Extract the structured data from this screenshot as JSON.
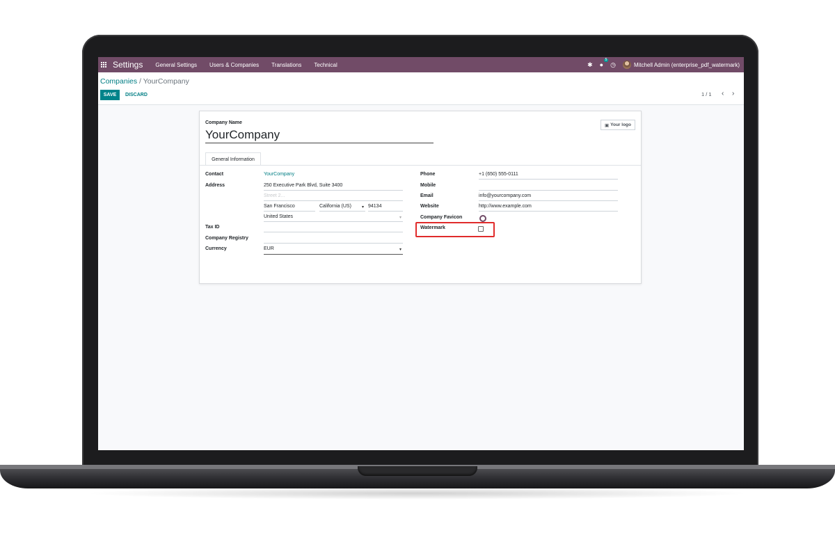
{
  "navbar": {
    "app_title": "Settings",
    "menu": [
      "General Settings",
      "Users & Companies",
      "Translations",
      "Technical"
    ],
    "chat_badge": "5",
    "user_name": "Mitchell Admin (enterprise_pdf_watermark)"
  },
  "breadcrumb": {
    "parent": "Companies",
    "separator": "/",
    "current": "YourCompany"
  },
  "actions": {
    "save": "SAVE",
    "discard": "DISCARD"
  },
  "pager": {
    "value": "1 / 1",
    "prev": "‹",
    "next": "›"
  },
  "form": {
    "company_name_label": "Company Name",
    "company_name": "YourCompany",
    "logo_button": "Your logo",
    "tab_label": "General Information",
    "left": {
      "contact_label": "Contact",
      "contact_value": "YourCompany",
      "address_label": "Address",
      "street": "250 Executive Park Blvd, Suite 3400",
      "street2_placeholder": "Street 2...",
      "city": "San Francisco",
      "state": "California (US)",
      "zip": "94134",
      "country": "United States",
      "tax_id_label": "Tax ID",
      "tax_id": "",
      "registry_label": "Company Registry",
      "registry": "",
      "currency_label": "Currency",
      "currency": "EUR"
    },
    "right": {
      "phone_label": "Phone",
      "phone": "+1 (650) 555-0111",
      "mobile_label": "Mobile",
      "mobile": "",
      "email_label": "Email",
      "email": "info@yourcompany.com",
      "website_label": "Website",
      "website": "http://www.example.com",
      "favicon_label": "Company Favicon",
      "watermark_label": "Watermark",
      "watermark_checked": false
    }
  },
  "colors": {
    "navbar": "#714b67",
    "primary": "#00838a",
    "link": "#017e84",
    "highlight": "#e02b2b"
  }
}
